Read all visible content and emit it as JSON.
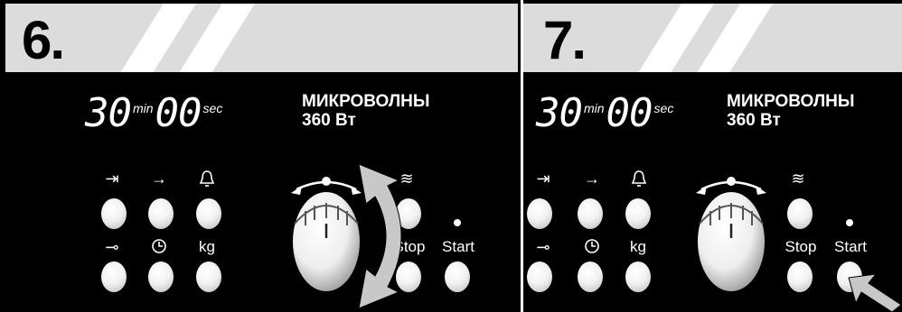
{
  "panels": [
    {
      "step": "6.",
      "clock": {
        "minutes": "30",
        "min_unit": "min",
        "seconds": "00",
        "sec_unit": "sec"
      },
      "mode": {
        "line1": "МИКРОВОЛНЫ",
        "line2": "360 Вт"
      },
      "icons": {
        "duration": "⇥",
        "end": "→",
        "timer": "♫",
        "microwave": "≋",
        "lock": "⊸",
        "clock": "⏱"
      },
      "labels": {
        "kg": "kg",
        "stop": "Stop",
        "start": "Start"
      }
    },
    {
      "step": "7.",
      "clock": {
        "minutes": "30",
        "min_unit": "min",
        "seconds": "00",
        "sec_unit": "sec"
      },
      "mode": {
        "line1": "МИКРОВОЛНЫ",
        "line2": "360 Вт"
      },
      "icons": {
        "duration": "⇥",
        "end": "→",
        "timer": "♫",
        "microwave": "≋",
        "lock": "⊸",
        "clock": "⏱"
      },
      "labels": {
        "kg": "kg",
        "stop": "Stop",
        "start": "Start"
      }
    }
  ],
  "colors": {
    "background": "#000000",
    "header": "#dcdcdc",
    "text": "#ffffff",
    "arrow": "#c8c8c8"
  }
}
